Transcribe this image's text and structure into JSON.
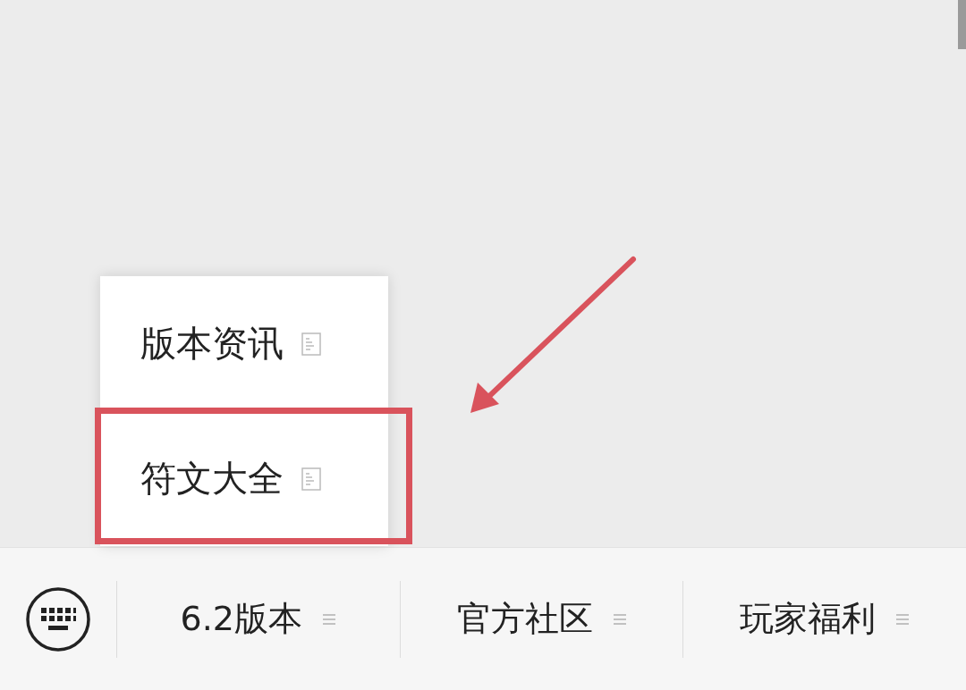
{
  "menu_bar": {
    "tabs": [
      {
        "label": "6.2版本",
        "items": [
          {
            "label": "版本资讯",
            "highlighted": false
          },
          {
            "label": "符文大全",
            "highlighted": true
          }
        ]
      },
      {
        "label": "官方社区"
      },
      {
        "label": "玩家福利"
      }
    ]
  }
}
